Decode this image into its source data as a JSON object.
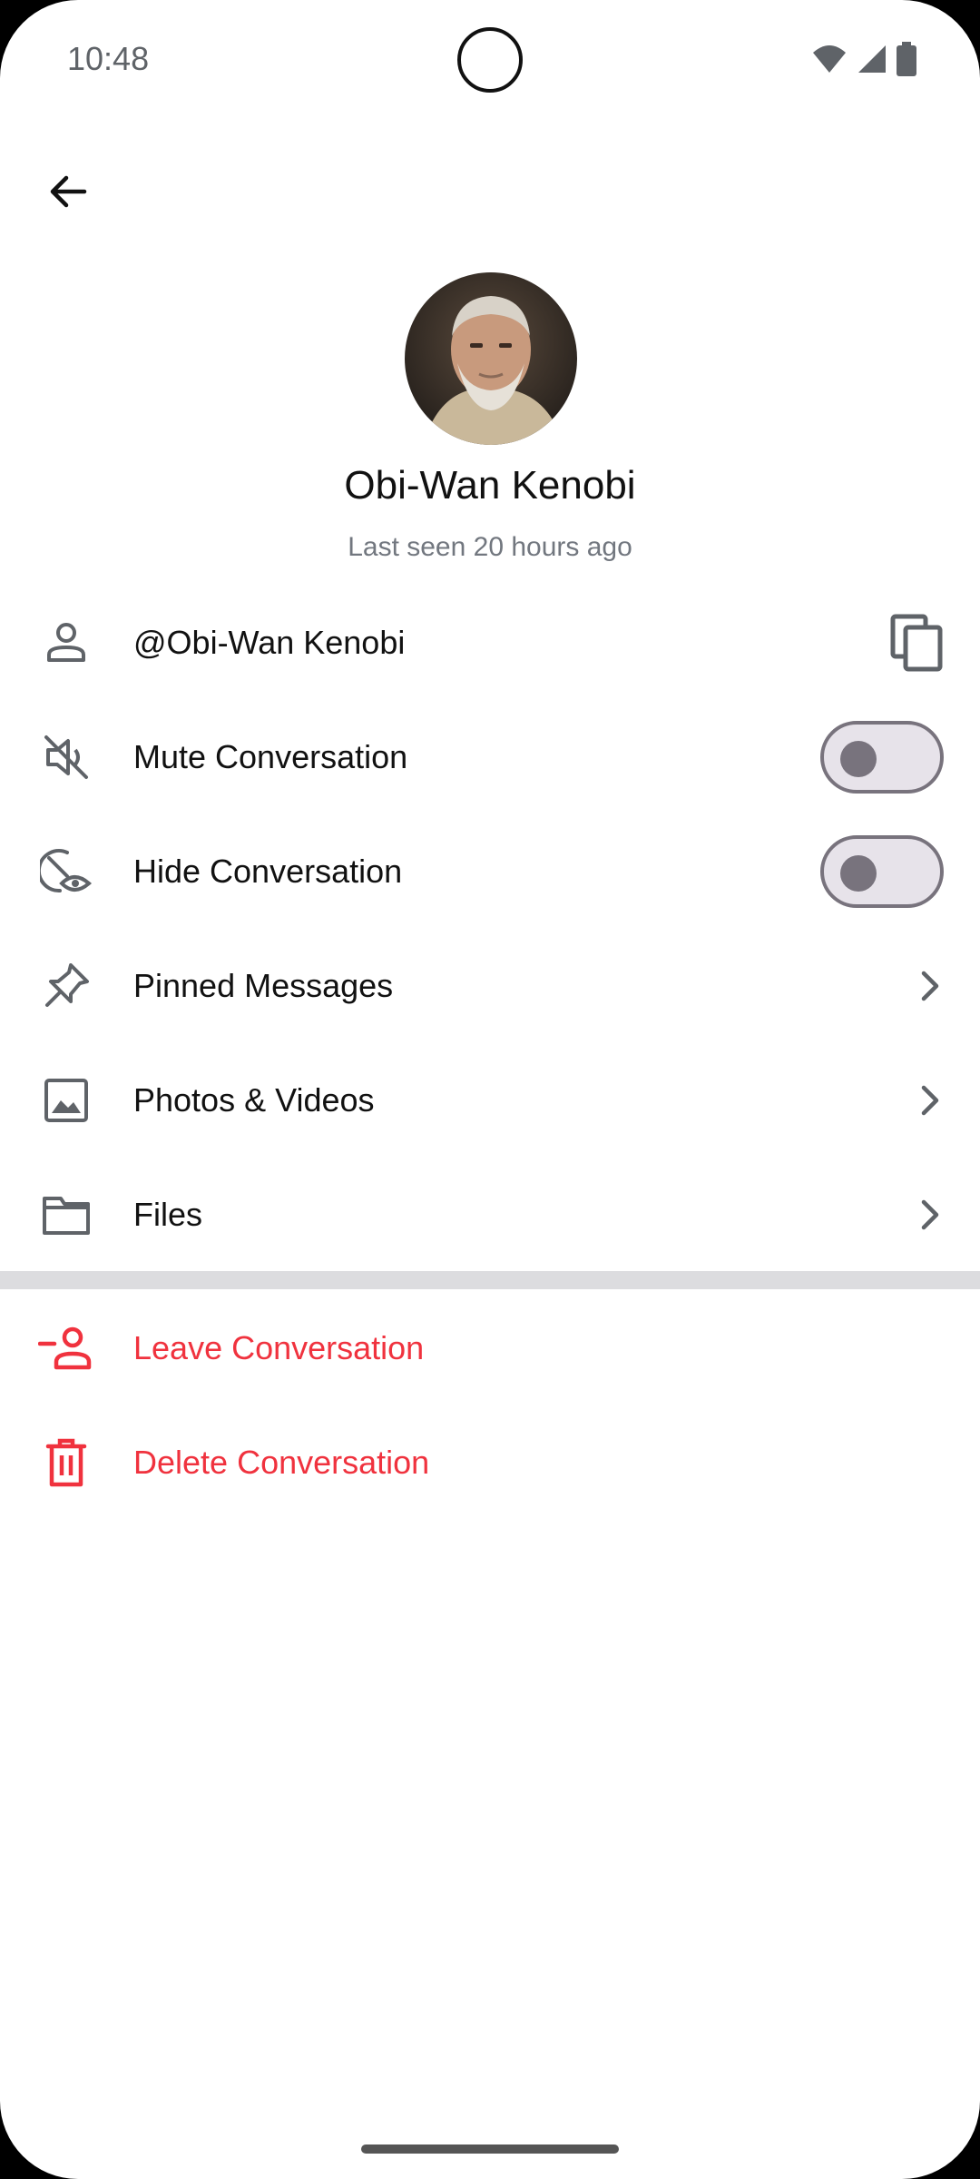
{
  "status_bar": {
    "time": "10:48"
  },
  "profile": {
    "name": "Obi-Wan Kenobi",
    "last_seen": "Last seen 20 hours ago"
  },
  "menu": {
    "username": "@Obi-Wan Kenobi",
    "mute": "Mute Conversation",
    "hide": "Hide Conversation",
    "pinned": "Pinned Messages",
    "photos": "Photos & Videos",
    "files": "Files"
  },
  "danger_actions": {
    "leave": "Leave Conversation",
    "delete": "Delete Conversation"
  },
  "toggles": {
    "mute_on": false,
    "hide_on": false
  },
  "colors": {
    "danger": "#f0323e",
    "text": "#111111",
    "muted": "#72777f"
  }
}
